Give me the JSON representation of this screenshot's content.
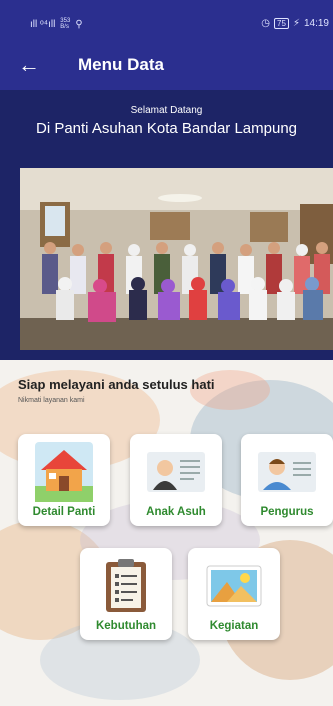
{
  "status_bar": {
    "signal": "ıll ᵒ⁴ıll",
    "speed_value": "353",
    "speed_unit": "B/s",
    "alarm": "◷",
    "battery": "75",
    "time": "14:19"
  },
  "app_bar": {
    "title": "Menu Data",
    "back_icon": "←"
  },
  "welcome": {
    "greeting": "Selamat Datang",
    "heading": "Di Panti Asuhan Kota Bandar Lampung"
  },
  "main": {
    "tagline": "Siap melayani anda setulus hati",
    "subtagline": "Nikmati layanan kami"
  },
  "menu": [
    {
      "label": "Detail Panti",
      "icon": "house-icon"
    },
    {
      "label": "Anak Asuh",
      "icon": "profile-card-icon"
    },
    {
      "label": "Pengurus",
      "icon": "staff-card-icon"
    },
    {
      "label": "Kebutuhan",
      "icon": "clipboard-icon"
    },
    {
      "label": "Kegiatan",
      "icon": "landscape-picture-icon"
    }
  ],
  "colors": {
    "primary": "#2b2f8f",
    "banner": "#1d2466",
    "menu_label": "#2f8a2f"
  }
}
